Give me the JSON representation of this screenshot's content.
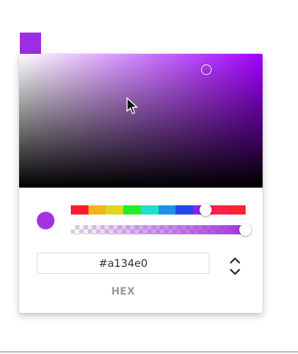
{
  "color": {
    "hex": "#a134e0",
    "alpha": 1.0
  },
  "swatch": {
    "color": "#9c2ee0"
  },
  "saturation_field": {
    "hue_color": "#a100ff",
    "saturation": 0.77,
    "brightness": 0.88
  },
  "hue_slider": {
    "bands": [
      "#ff1b33",
      "#f2b41a",
      "#dcd71d",
      "#27ec2a",
      "#1fe0c8",
      "#1d92e8",
      "#2348e6",
      "#8b22f0",
      "#ff2047",
      "#ff2031"
    ],
    "value": 0.773
  },
  "alpha_slider": {
    "color": "#a134e0",
    "value": 1.0
  },
  "hex_field": {
    "value": "#a134e0"
  },
  "format": {
    "label": "HEX"
  },
  "icons": {
    "cursor": "arrow-cursor-icon",
    "format_toggle": "chevron-up-down-icon"
  }
}
